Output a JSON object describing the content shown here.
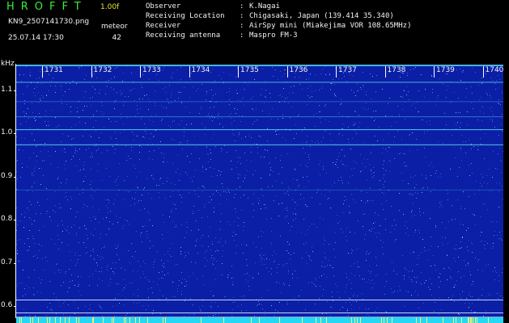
{
  "header": {
    "app_title": "HROFFT",
    "version": "1.00f",
    "filename": "KN9_2507141730.png",
    "meteor_label": "meteor",
    "datetime": "25.07.14 17:30",
    "meteor_count": "42"
  },
  "station_info": [
    {
      "key": "Observer",
      "value": "K.Nagai"
    },
    {
      "key": "Receiving Location",
      "value": "Chigasaki, Japan (139.414 35.340)"
    },
    {
      "key": "Receiver",
      "value": "AirSpy mini (Miakejima VOR 108.65MHz)"
    },
    {
      "key": "Receiving antenna",
      "value": "Maspro FM-3"
    }
  ],
  "separator": ":",
  "axis": {
    "unit": "kHz",
    "y_ticks": [
      {
        "label": "1.1",
        "value": 1.1
      },
      {
        "label": "1.0",
        "value": 1.0
      },
      {
        "label": "0.9",
        "value": 0.9
      },
      {
        "label": "0.8",
        "value": 0.8
      },
      {
        "label": "0.7",
        "value": 0.7
      },
      {
        "label": "0.6",
        "value": 0.6
      }
    ],
    "y_range": [
      0.57,
      1.16
    ]
  },
  "time_marks": [
    "1731",
    "1732",
    "1733",
    "1734",
    "1735",
    "1736",
    "1737",
    "1738",
    "1739",
    "1740"
  ],
  "colors": {
    "background": "#0b1fa6",
    "carrier": "#56d8f0",
    "bottom_band": "#22d8f5",
    "title": "#35f03a",
    "version": "#e8e63a"
  }
}
